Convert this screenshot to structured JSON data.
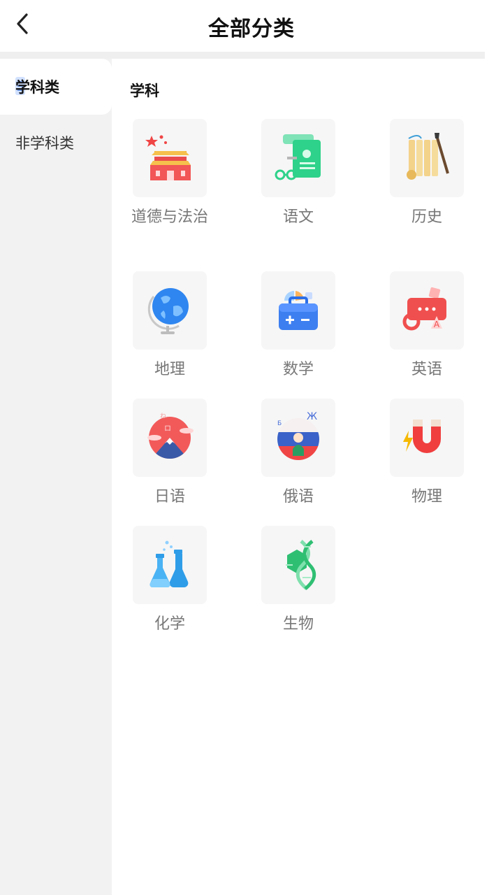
{
  "header": {
    "title": "全部分类",
    "back_icon": "chevron-left-icon"
  },
  "sidebar": {
    "items": [
      {
        "label": "学科类",
        "active": true
      },
      {
        "label": "非学科类",
        "active": false
      }
    ]
  },
  "main": {
    "section_title": "学科",
    "subjects": [
      {
        "label": "道德与法治",
        "icon": "tiananmen-icon"
      },
      {
        "label": "语文",
        "icon": "scroll-certificate-icon"
      },
      {
        "label": "历史",
        "icon": "bamboo-slips-icon"
      },
      {
        "label": "地理",
        "icon": "globe-icon"
      },
      {
        "label": "数学",
        "icon": "math-toolbox-icon"
      },
      {
        "label": "英语",
        "icon": "chat-bubble-abc-icon"
      },
      {
        "label": "日语",
        "icon": "mount-fuji-icon"
      },
      {
        "label": "俄语",
        "icon": "russia-icon"
      },
      {
        "label": "物理",
        "icon": "magnet-icon"
      },
      {
        "label": "化学",
        "icon": "flask-icon"
      },
      {
        "label": "生物",
        "icon": "dna-icon"
      }
    ]
  },
  "colors": {
    "sidebar_bg": "#f2f2f2",
    "tile_bg": "#f6f6f6",
    "label_gray": "#777777"
  }
}
